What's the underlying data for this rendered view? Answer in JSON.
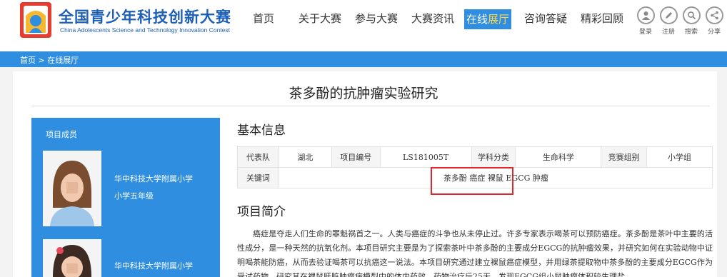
{
  "logo": {
    "title": "全国青少年科技创新大赛",
    "subtitle": "China Adolescents Science and Technology Innovation Contest"
  },
  "nav": [
    {
      "label": "首页"
    },
    {
      "label": "关于大赛"
    },
    {
      "label": "参与大赛"
    },
    {
      "label": "大赛资讯"
    },
    {
      "label_a": "在线",
      "label_b": "展厅",
      "active": true
    },
    {
      "label": "咨询答疑"
    },
    {
      "label": "精彩回顾"
    }
  ],
  "tools": [
    {
      "label": "登录",
      "icon": "user-icon"
    },
    {
      "label": "注册",
      "icon": "pencil-icon"
    },
    {
      "label": "搜索",
      "icon": "search-icon"
    },
    {
      "label": "分享",
      "icon": "share-icon"
    }
  ],
  "breadcrumb": {
    "home": "首页",
    "sep": " > ",
    "current": "在线展厅"
  },
  "page_title": "茶多酚的抗肿瘤实验研究",
  "members": {
    "heading": "项目成员",
    "list": [
      {
        "school": "华中科技大学附属小学",
        "grade": "小学五年级"
      },
      {
        "school": "华中科技大学附属小学",
        "grade": ""
      }
    ]
  },
  "basic_info": {
    "heading": "基本信息",
    "labels": {
      "team": "代表队",
      "code": "项目编号",
      "subject": "学科分类",
      "group": "竞赛组别",
      "keywords": "关键词"
    },
    "values": {
      "team": "湖北",
      "code": "LS181005T",
      "subject": "生命科学",
      "group": "小学组",
      "keywords": "茶多酚 癌症 裸鼠 EGCG 肿瘤"
    }
  },
  "intro": {
    "heading": "项目简介",
    "text": "癌症是夺走人们生命的罪魁祸首之一。人类与癌症的斗争也从未停止过。许多专家表示喝茶可以预防癌症。茶多酚是茶叶中主要的活性成分，是一种天然的抗氧化剂。本项目研究主要是为了探索茶叶中茶多酚的主要成分EGCG的抗肿瘤效果，并研究如何在实验动物中证明喝茶能防癌，从而去验证喝茶可以抗癌这一说法。本项目研究通过建立裸鼠癌症模型，并用绿茶提取物中茶多酚的主要成分EGCG作为受试药物，研究其在裸鼠肝脏肿瘤病模型中的体内药效。药物治疗后25天，发现EGCG组小鼠肿瘤体积较生理盐"
  },
  "colors": {
    "brand": "#2f8ee0",
    "logo_blue": "#1d5fb7",
    "highlight_box": "#e3262b"
  }
}
